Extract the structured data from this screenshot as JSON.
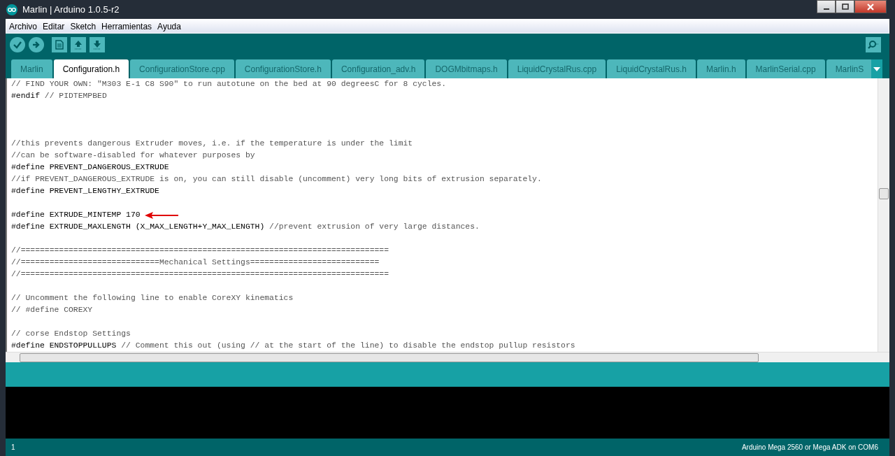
{
  "window": {
    "title": "Marlin | Arduino 1.0.5-r2"
  },
  "menu": [
    "Archivo",
    "Editar",
    "Sketch",
    "Herramientas",
    "Ayuda"
  ],
  "tabs": [
    {
      "label": "Marlin",
      "selected": false
    },
    {
      "label": "Configuration.h",
      "selected": true
    },
    {
      "label": "ConfigurationStore.cpp",
      "selected": false
    },
    {
      "label": "ConfigurationStore.h",
      "selected": false
    },
    {
      "label": "Configuration_adv.h",
      "selected": false
    },
    {
      "label": "DOGMbitmaps.h",
      "selected": false
    },
    {
      "label": "LiquidCrystalRus.cpp",
      "selected": false
    },
    {
      "label": "LiquidCrystalRus.h",
      "selected": false
    },
    {
      "label": "Marlin.h",
      "selected": false
    },
    {
      "label": "MarlinSerial.cpp",
      "selected": false
    },
    {
      "label": "MarlinS",
      "selected": false
    }
  ],
  "editor": {
    "lines": [
      {
        "kind": "code",
        "segments": [
          {
            "kind": "comment",
            "text": "// FIND YOUR OWN: \"M303 E-1 C8 S90\" to run autotune on the bed at 90 degreesC for 8 cycles."
          }
        ]
      },
      {
        "kind": "code",
        "segments": [
          {
            "kind": "keyword",
            "text": "#endif"
          },
          {
            "kind": "comment",
            "text": " // PIDTEMPBED"
          }
        ]
      },
      {
        "kind": "blank"
      },
      {
        "kind": "blank"
      },
      {
        "kind": "blank"
      },
      {
        "kind": "code",
        "segments": [
          {
            "kind": "comment",
            "text": "//this prevents dangerous Extruder moves, i.e. if the temperature is under the limit"
          }
        ]
      },
      {
        "kind": "code",
        "segments": [
          {
            "kind": "comment",
            "text": "//can be software-disabled for whatever purposes by"
          }
        ]
      },
      {
        "kind": "code",
        "segments": [
          {
            "kind": "keyword",
            "text": "#define PREVENT_DANGEROUS_EXTRUDE"
          }
        ]
      },
      {
        "kind": "code",
        "segments": [
          {
            "kind": "comment",
            "text": "//if PREVENT_DANGEROUS_EXTRUDE is on, you can still disable (uncomment) very long bits of extrusion separately."
          }
        ]
      },
      {
        "kind": "code",
        "segments": [
          {
            "kind": "keyword",
            "text": "#define PREVENT_LENGTHY_EXTRUDE"
          }
        ]
      },
      {
        "kind": "blank"
      },
      {
        "kind": "code",
        "marked": true,
        "segments": [
          {
            "kind": "keyword",
            "text": "#define EXTRUDE_MINTEMP 170"
          }
        ]
      },
      {
        "kind": "code",
        "segments": [
          {
            "kind": "keyword",
            "text": "#define EXTRUDE_MAXLENGTH (X_MAX_LENGTH+Y_MAX_LENGTH)"
          },
          {
            "kind": "comment",
            "text": " //prevent extrusion of very large distances."
          }
        ]
      },
      {
        "kind": "blank"
      },
      {
        "kind": "code",
        "segments": [
          {
            "kind": "comment",
            "text": "//============================================================================="
          }
        ]
      },
      {
        "kind": "code",
        "segments": [
          {
            "kind": "comment",
            "text": "//=============================Mechanical Settings==========================="
          }
        ]
      },
      {
        "kind": "code",
        "segments": [
          {
            "kind": "comment",
            "text": "//============================================================================="
          }
        ]
      },
      {
        "kind": "blank"
      },
      {
        "kind": "code",
        "segments": [
          {
            "kind": "comment",
            "text": "// Uncomment the following line to enable CoreXY kinematics"
          }
        ]
      },
      {
        "kind": "code",
        "segments": [
          {
            "kind": "comment",
            "text": "// #define COREXY"
          }
        ]
      },
      {
        "kind": "blank"
      },
      {
        "kind": "code",
        "segments": [
          {
            "kind": "comment",
            "text": "// corse Endstop Settings"
          }
        ]
      },
      {
        "kind": "code",
        "segments": [
          {
            "kind": "keyword",
            "text": "#define ENDSTOPPULLUPS"
          },
          {
            "kind": "comment",
            "text": " // Comment this out (using // at the start of the line) to disable the endstop pullup resistors"
          }
        ]
      }
    ]
  },
  "status_bar": {
    "line": "1",
    "board": "Arduino Mega 2560 or Mega ADK on COM6"
  }
}
